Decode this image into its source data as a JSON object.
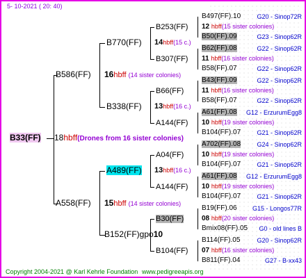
{
  "header": {
    "date": "5- 10-2021  ( 20: 40)"
  },
  "footer": {
    "copyright": "Copyright 2004-2021 @ Karl Kehrle Foundation",
    "website": "www.pedigreeapis.org"
  },
  "root": {
    "id": "B33(FF)",
    "num": "18",
    "hbff": "hbff",
    "note": "(Drones from 16 sister colonies)"
  },
  "gen1": {
    "top": {
      "id": "B586(FF)",
      "num": "16",
      "hbff": "hbff",
      "note": "(14 sister colonies)"
    },
    "bottom": {
      "id": "A558(FF)",
      "num": "15",
      "hbff": "hbff",
      "note": "(14 sister colonies)"
    }
  },
  "gen2": {
    "b770": {
      "id": "B770(FF)",
      "num": "14",
      "hbff": "hbff",
      "note": "(15 c.)"
    },
    "b338": {
      "id": "B338(FF)",
      "num": "13",
      "hbff": "hbff",
      "note": "(16 c.)"
    },
    "a489": {
      "id": "A489(FF)",
      "num": "13",
      "hbff": "hbff",
      "note": "(16 c.)"
    },
    "b152": {
      "id": "B152(FF)gpo",
      "num": "10"
    }
  },
  "gen3": {
    "b253": {
      "id": "B253(FF)"
    },
    "b307": {
      "id": "B307(FF)"
    },
    "b66": {
      "id": "B66(FF)",
      "num": "11",
      "hbff": "hbff",
      "note": "(16 colonies)"
    },
    "a144a": {
      "id": "A144(FF)"
    },
    "a04": {
      "id": "A04(FF)"
    },
    "a144b": {
      "id": "A144(FF)"
    },
    "b30": {
      "id": "B30(FF)"
    },
    "b104": {
      "id": "B104(FF)"
    }
  },
  "gen4": [
    {
      "id": "B497(FF).10",
      "info": "G20 - Sinop72R"
    },
    {
      "num": "12",
      "hbff": "hbff",
      "note": "(15 sister colonies)"
    },
    {
      "id": "B50(FF).09",
      "info": "G23 - Sinop62R"
    },
    {
      "id": "B62(FF).08",
      "info": "G22 - Sinop62R"
    },
    {
      "num": "11",
      "hbff": "hbff",
      "note": "(16 sister colonies)"
    },
    {
      "id": "B58(FF).07",
      "info": "G22 - Sinop62R"
    },
    {
      "id": "B43(FF).09",
      "info": "G22 - Sinop62R"
    },
    {
      "num": "11",
      "hbff": "hbff",
      "note": "(16 sister colonies)"
    },
    {
      "id": "B58(FF).07",
      "info": "G22 - Sinop62R"
    },
    {
      "id": "A61(FF).08",
      "info": "G12 - ErzurumEgg8"
    },
    {
      "num": "10",
      "hbff": "hbff",
      "note": "(19 sister colonies)"
    },
    {
      "id": "B104(FF).07",
      "info": "G21 - Sinop62R"
    },
    {
      "id": "A702(FF).08",
      "info": "G24 - Sinop62R"
    },
    {
      "num": "10",
      "hbff": "hbff",
      "note": "(19 sister colonies)"
    },
    {
      "id": "B104(FF).07",
      "info": "G21 - Sinop62R"
    },
    {
      "id": "A61(FF).08",
      "info": "G12 - ErzurumEgg8"
    },
    {
      "num": "10",
      "hbff": "hbff",
      "note": "(19 sister colonies)"
    },
    {
      "id": "B104(FF).07",
      "info": "G21 - Sinop62R"
    },
    {
      "id": "B19(FF).06",
      "info": "G15 - Longos77R"
    },
    {
      "num": "08",
      "hbff": "hbff",
      "note": "(20 sister colonies)"
    },
    {
      "id": "Bmix08(FF).05",
      "info": "G0 - old lines B"
    },
    {
      "id": "B114(FF).05",
      "info": "G20 - Sinop62R"
    },
    {
      "num": "07",
      "hbff": "hbff",
      "note": "(16 sister colonies)"
    },
    {
      "id": "B811(FF).04",
      "info": "G27 - B-xx43"
    }
  ]
}
